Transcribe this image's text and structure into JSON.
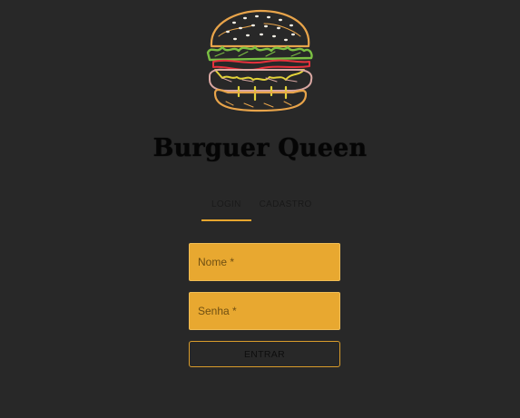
{
  "app": {
    "title": "Burguer Queen",
    "logo_icon": "burger-icon"
  },
  "tabs": [
    {
      "label": "LOGIN",
      "active": true
    },
    {
      "label": "CADASTRO",
      "active": false
    }
  ],
  "form": {
    "name_placeholder": "Nome *",
    "password_placeholder": "Senha *",
    "submit_label": "ENTRAR"
  },
  "colors": {
    "background": "#282828",
    "accent": "#e8a830",
    "title": "#050505"
  }
}
